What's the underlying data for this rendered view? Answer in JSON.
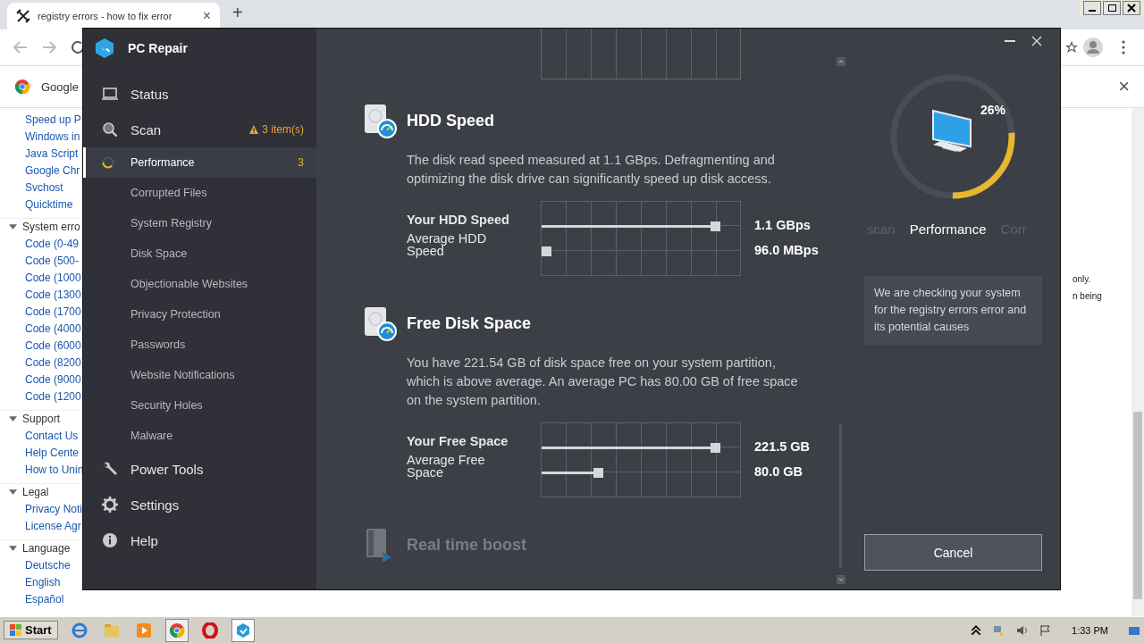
{
  "browser": {
    "tab": {
      "title": "registry errors - how to fix error",
      "close": "×"
    },
    "new_tab": "+",
    "bookmark": "Google",
    "infobar_close": "×",
    "nav": [
      {
        "kind": "link",
        "label": "Speed up P"
      },
      {
        "kind": "link",
        "label": "Windows in"
      },
      {
        "kind": "link",
        "label": "Java Script"
      },
      {
        "kind": "link",
        "label": "Google Chr"
      },
      {
        "kind": "link",
        "label": "Svchost"
      },
      {
        "kind": "link",
        "label": "Quicktime"
      },
      {
        "kind": "group",
        "label": "System erro"
      },
      {
        "kind": "link",
        "label": "Code (0-49"
      },
      {
        "kind": "link",
        "label": "Code (500-"
      },
      {
        "kind": "link",
        "label": "Code (1000"
      },
      {
        "kind": "link",
        "label": "Code (1300"
      },
      {
        "kind": "link",
        "label": "Code (1700"
      },
      {
        "kind": "link",
        "label": "Code (4000"
      },
      {
        "kind": "link",
        "label": "Code (6000"
      },
      {
        "kind": "link",
        "label": "Code (8200"
      },
      {
        "kind": "link",
        "label": "Code (9000"
      },
      {
        "kind": "link",
        "label": "Code (1200"
      },
      {
        "kind": "group",
        "label": "Support"
      },
      {
        "kind": "link",
        "label": "Contact Us"
      },
      {
        "kind": "link",
        "label": "Help Cente"
      },
      {
        "kind": "link",
        "label": "How to Unin"
      },
      {
        "kind": "group",
        "label": "Legal"
      },
      {
        "kind": "link",
        "label": "Privacy Noti"
      },
      {
        "kind": "link",
        "label": "License Agr"
      },
      {
        "kind": "group",
        "label": "Language"
      },
      {
        "kind": "link",
        "label": "Deutsche"
      },
      {
        "kind": "link",
        "label": "English"
      },
      {
        "kind": "link",
        "label": "Español"
      }
    ],
    "page_fragments": [
      "only.",
      "n being"
    ]
  },
  "app": {
    "title": "PC Repair",
    "nav": [
      {
        "kind": "main",
        "label": "Status",
        "selected": false
      },
      {
        "kind": "main",
        "label": "Scan",
        "badge": "3 item(s)",
        "selected": false
      },
      {
        "kind": "step",
        "label": "Performance",
        "count": "3",
        "selected": true
      },
      {
        "kind": "step",
        "label": "Corrupted Files",
        "selected": false
      },
      {
        "kind": "step",
        "label": "System Registry",
        "selected": false
      },
      {
        "kind": "step",
        "label": "Disk Space",
        "selected": false
      },
      {
        "kind": "step",
        "label": "Objectionable Websites",
        "selected": false
      },
      {
        "kind": "step",
        "label": "Privacy Protection",
        "selected": false
      },
      {
        "kind": "step",
        "label": "Passwords",
        "selected": false
      },
      {
        "kind": "step",
        "label": "Website Notifications",
        "selected": false
      },
      {
        "kind": "step",
        "label": "Security Holes",
        "selected": false
      },
      {
        "kind": "step",
        "label": "Malware",
        "selected": false
      },
      {
        "kind": "main",
        "label": "Power Tools",
        "selected": false
      },
      {
        "kind": "main",
        "label": "Settings",
        "selected": false
      },
      {
        "kind": "main",
        "label": "Help",
        "selected": false
      }
    ],
    "sections": [
      {
        "title": "HDD Speed",
        "disabled": false,
        "description": "The disk read speed measured at 1.1 GBps. Defragmenting and optimizing the disk drive can significantly speed up disk access.",
        "meters": [
          {
            "kind": "yours",
            "label": "Your HDD Speed",
            "level": 0.9,
            "reading": "1.1 GBps"
          },
          {
            "kind": "average",
            "label": "Average HDD Speed",
            "level": 0.05,
            "reading": "96.0 MBps"
          }
        ]
      },
      {
        "title": "Free Disk Space",
        "disabled": false,
        "description": "You have 221.54 GB of disk space free on your system partition, which is above average. An average PC has 80.00 GB of free space on the system partition.",
        "meters": [
          {
            "kind": "yours",
            "label": "Your Free Space",
            "level": 0.9,
            "reading": "221.5 GB"
          },
          {
            "kind": "average",
            "label": "Average Free Space",
            "level": 0.31,
            "reading": "80.0 GB"
          }
        ]
      },
      {
        "title": "Real time boost",
        "disabled": true
      }
    ],
    "progress": {
      "level": 0.26,
      "reading": "26%"
    },
    "steps": [
      {
        "label": "scan",
        "selected": false
      },
      {
        "label": "Performance",
        "selected": true
      },
      {
        "label": "Corr",
        "selected": false
      }
    ],
    "status_message": "We are checking your system for the registry errors error and its potential causes",
    "cancel": "Cancel"
  },
  "taskbar": {
    "start": "Start",
    "clock": "1:33 PM"
  }
}
